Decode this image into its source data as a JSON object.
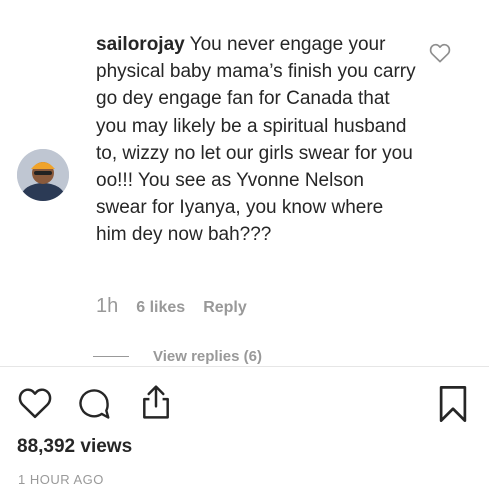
{
  "comment": {
    "username": "sailorojay",
    "text": " You never engage your physical baby mama’s finish you carry go dey engage fan for Canada that you may likely be a spiritual husband to, wizzy no let our girls swear for you oo!!! You see as Yvonne Nelson swear for Iyanya, you know where him dey now bah???",
    "time": "1h",
    "likes": "6 likes",
    "reply_label": "Reply",
    "view_replies": "View replies (6)"
  },
  "post": {
    "views": "88,392 views",
    "time_ago": "1 HOUR AGO"
  },
  "icons": {
    "comment_like": "heart-outline-icon",
    "like": "heart-outline-icon",
    "comment": "speech-bubble-icon",
    "share": "share-upload-icon",
    "save": "bookmark-icon"
  },
  "colors": {
    "text": "#262626",
    "secondary": "#999999",
    "divider": "#e6e6e6"
  }
}
